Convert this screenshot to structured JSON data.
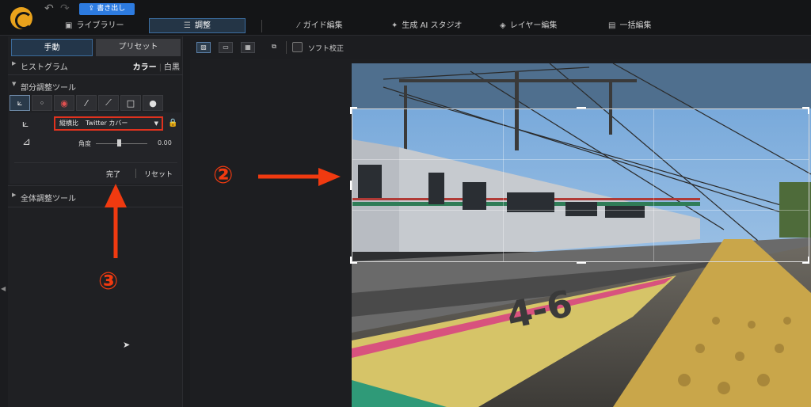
{
  "topbar": {
    "export_label": "書き出し",
    "nav": [
      {
        "label": "ライブラリー",
        "icon": "library-icon"
      },
      {
        "label": "調整",
        "icon": "sliders-icon"
      },
      {
        "label": "ガイド編集",
        "icon": "wand-icon"
      },
      {
        "label": "生成 AI スタジオ",
        "icon": "sparkle-icon"
      },
      {
        "label": "レイヤー編集",
        "icon": "layers-icon"
      },
      {
        "label": "一括編集",
        "icon": "batch-icon"
      }
    ]
  },
  "left": {
    "tabs": {
      "manual": "手動",
      "preset": "プリセット"
    },
    "histogram": {
      "label": "ヒストグラム",
      "color": "カラー",
      "bw": "白黒"
    },
    "partial": {
      "label": "部分調整ツール"
    },
    "aspect": {
      "label": "縦横比",
      "value": "Twitter カバー"
    },
    "angle": {
      "label": "角度",
      "value": "0.00",
      "level": 0.5
    },
    "done": "完了",
    "reset": "リセット",
    "global": {
      "label": "全体調整ツール"
    }
  },
  "viewer": {
    "soft_label": "ソフト校正"
  },
  "annotations": {
    "num2": "②",
    "num3": "③"
  },
  "colors": {
    "accent": "#2d7be0",
    "annotation": "#f03a10",
    "highlight_box": "#e0321e"
  }
}
